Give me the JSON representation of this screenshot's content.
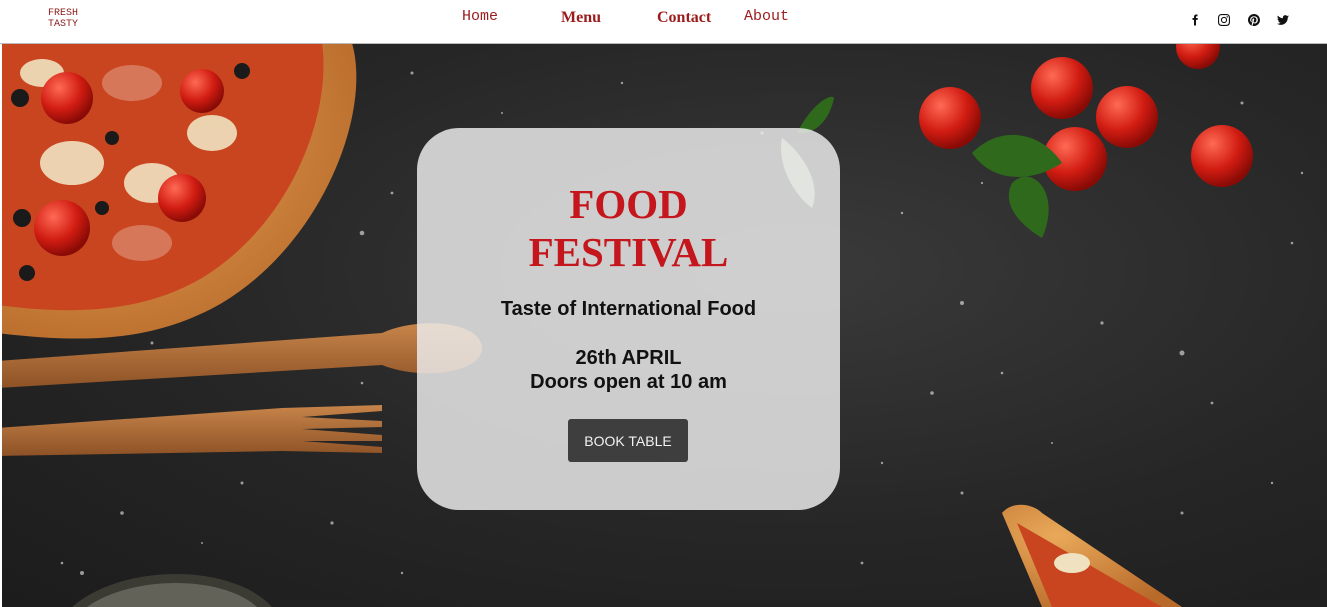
{
  "navbar": {
    "logo_line1": "FRESH",
    "logo_line2": "TASTY",
    "links": [
      {
        "label": "Home"
      },
      {
        "label": "Menu"
      },
      {
        "label": "Contact"
      },
      {
        "label": "About"
      }
    ],
    "social_icons": [
      "facebook-icon",
      "instagram-icon",
      "pinterest-icon",
      "twitter-icon"
    ]
  },
  "hero": {
    "title_line1": "FOOD",
    "title_line2": "FESTIVAL",
    "subtitle": "Taste of International Food",
    "date": "26th APRIL",
    "time": "Doors open at 10 am",
    "button_label": "BOOK TABLE"
  },
  "colors": {
    "accent_red": "#c4161c",
    "nav_link": "#9b1c1c",
    "button_bg": "#3e3e3e",
    "card_bg": "#ececec"
  }
}
